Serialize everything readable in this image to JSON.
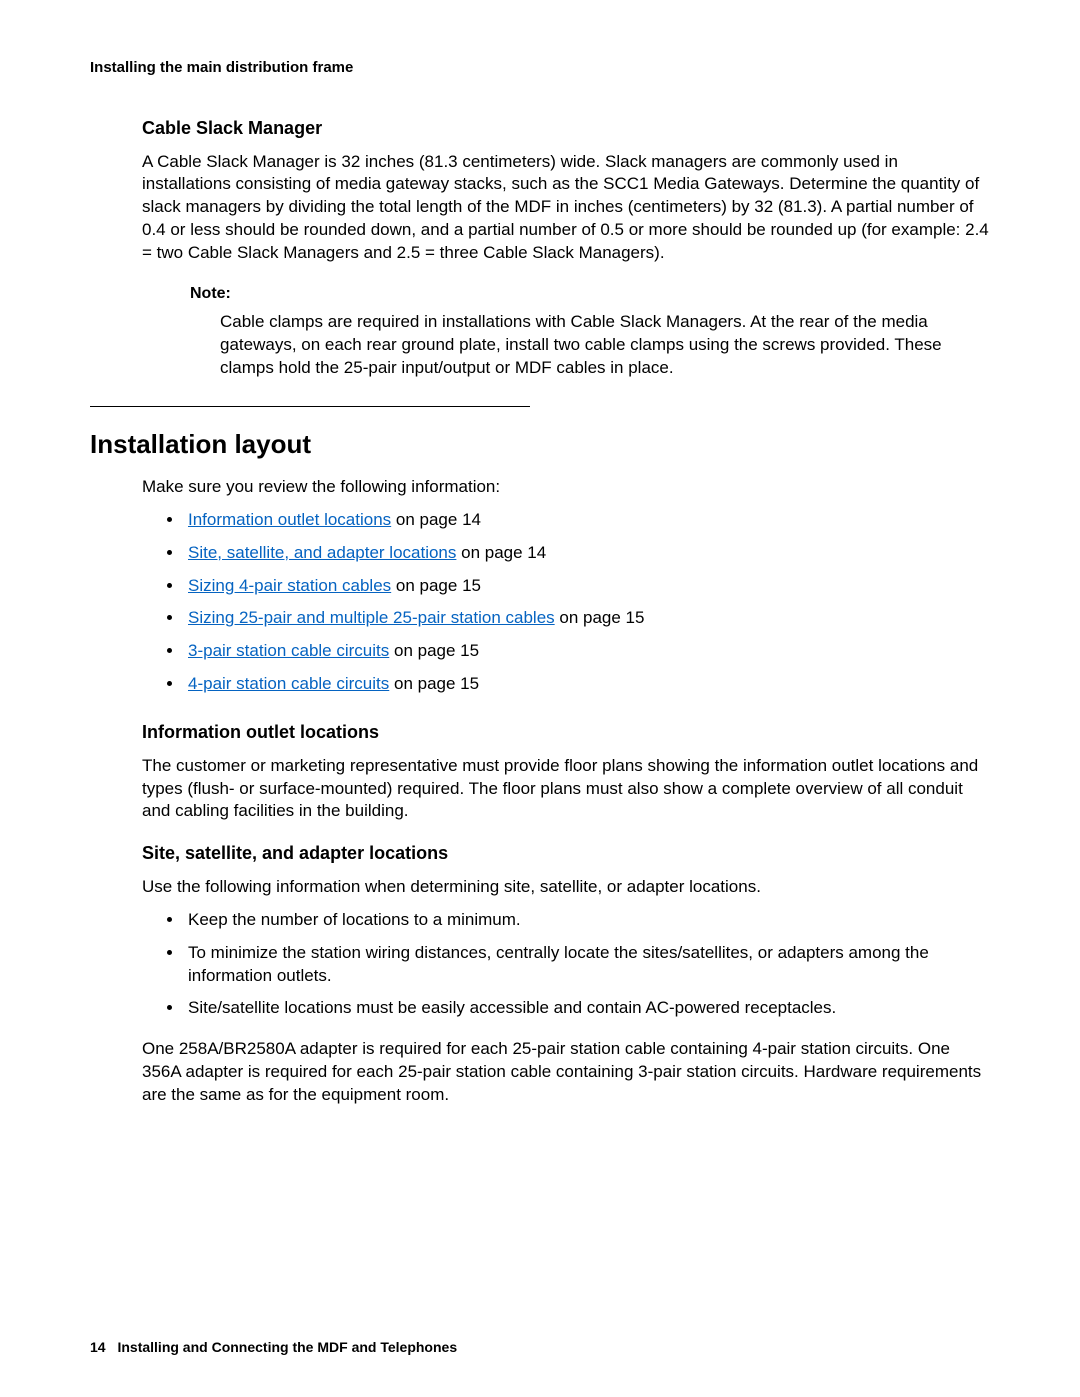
{
  "header": {
    "running": "Installing the main distribution frame"
  },
  "section1": {
    "heading": "Cable Slack Manager",
    "para": "A Cable Slack Manager is 32 inches (81.3 centimeters) wide. Slack managers are commonly used in installations consisting of media gateway stacks, such as the SCC1 Media Gateways. Determine the quantity of slack managers by dividing the total length of the MDF in inches (centimeters) by 32 (81.3). A partial number of 0.4 or less should be rounded down, and a partial number of 0.5 or more should be rounded up (for example: 2.4 = two Cable Slack Managers and 2.5 = three Cable Slack Managers).",
    "note_label": "Note:",
    "note_body": "Cable clamps are required in installations with Cable Slack Managers. At the rear of the media gateways, on each rear ground plate, install two cable clamps using the screws provided. These clamps hold the 25-pair input/output or MDF cables in place."
  },
  "section2": {
    "heading": "Installation layout",
    "intro": "Make sure you review the following information:",
    "links": [
      {
        "text": "Information outlet locations",
        "suffix": " on page 14"
      },
      {
        "text": "Site, satellite, and adapter locations",
        "suffix": " on page 14"
      },
      {
        "text": "Sizing 4-pair station cables",
        "suffix": " on page 15"
      },
      {
        "text": "Sizing 25-pair and multiple 25-pair station cables",
        "suffix": " on page 15"
      },
      {
        "text": "3-pair station cable circuits",
        "suffix": " on page 15"
      },
      {
        "text": "4-pair station cable circuits",
        "suffix": " on page 15"
      }
    ]
  },
  "section3": {
    "heading": "Information outlet locations",
    "para": "The customer or marketing representative must provide floor plans showing the information outlet locations and types (flush- or surface-mounted) required. The floor plans must also show a complete overview of all conduit and cabling facilities in the building."
  },
  "section4": {
    "heading": "Site, satellite, and adapter locations",
    "intro": "Use the following information when determining site, satellite, or adapter locations.",
    "bullets": [
      "Keep the number of locations to a minimum.",
      "To minimize the station wiring distances, centrally locate the sites/satellites, or adapters among the information outlets.",
      "Site/satellite locations must be easily accessible and contain AC-powered receptacles."
    ],
    "para2": "One 258A/BR2580A adapter is required for each 25-pair station cable containing 4-pair station circuits. One 356A adapter is required for each 25-pair station cable containing 3-pair station circuits. Hardware requirements are the same as for the equipment room."
  },
  "footer": {
    "page_number": "14",
    "title": "Installing and Connecting the MDF and Telephones"
  }
}
